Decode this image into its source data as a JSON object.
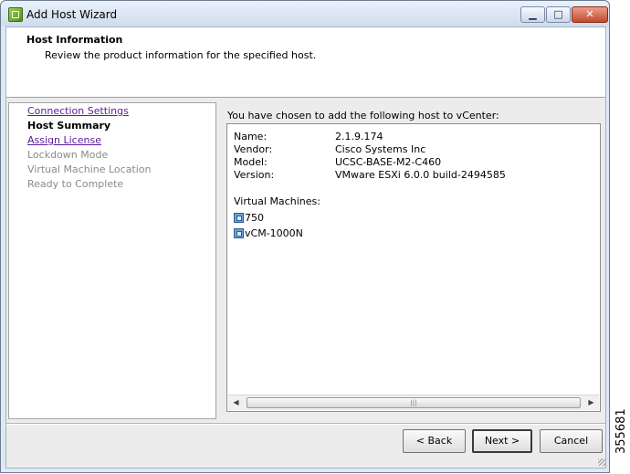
{
  "window": {
    "title": "Add Host Wizard",
    "minimize_glyph": "▁",
    "maximize_glyph": "□",
    "close_glyph": "✕"
  },
  "header": {
    "title": "Host Information",
    "subtitle": "Review the product information for the specified host."
  },
  "nav": {
    "items": [
      {
        "label": "Connection Settings",
        "state": "link"
      },
      {
        "label": "Host Summary",
        "state": "current"
      },
      {
        "label": "Assign License",
        "state": "link"
      },
      {
        "label": "Lockdown Mode",
        "state": "disabled"
      },
      {
        "label": "Virtual Machine Location",
        "state": "disabled"
      },
      {
        "label": "Ready to Complete",
        "state": "disabled"
      }
    ]
  },
  "content": {
    "intro": "You have chosen to add the following host to vCenter:",
    "fields": [
      {
        "label": "Name:",
        "value": "2.1.9.174"
      },
      {
        "label": "Vendor:",
        "value": "Cisco Systems Inc"
      },
      {
        "label": "Model:",
        "value": "UCSC-BASE-M2-C460"
      },
      {
        "label": "Version:",
        "value": "VMware ESXi 6.0.0 build-2494585"
      }
    ],
    "vm_heading": "Virtual Machines:",
    "vms": [
      "750",
      "vCM-1000N"
    ]
  },
  "scrollbar": {
    "left_glyph": "◀",
    "right_glyph": "▶",
    "grip_glyph": "|||"
  },
  "buttons": {
    "back": "< Back",
    "next": "Next >",
    "cancel": "Cancel"
  },
  "figure_id": "355681",
  "colors": {
    "link": "#5b1a9d",
    "disabled": "#8a8a8a",
    "close_button": "#c24a2c"
  },
  "icons": [
    "wizard-app-icon",
    "virtual-machine-icon"
  ]
}
